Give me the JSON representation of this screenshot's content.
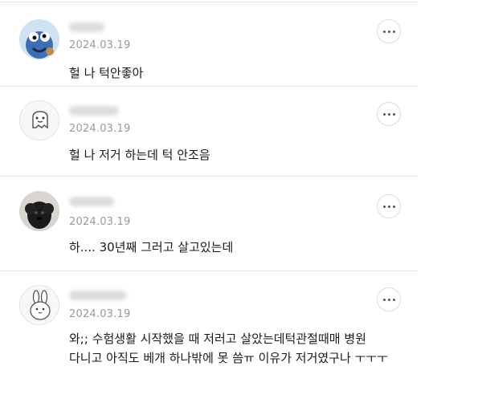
{
  "comments": [
    {
      "date": "2024.03.19",
      "text": "헐 나 턱안좋아",
      "avatar": "cookie-monster-avatar"
    },
    {
      "date": "2024.03.19",
      "text": "헐 나 저거 하는데 턱 안조음",
      "avatar": "ghost-character-avatar"
    },
    {
      "date": "2024.03.19",
      "text": "하.... 30년째 그러고 살고있는데",
      "avatar": "black-dog-avatar"
    },
    {
      "date": "2024.03.19",
      "text": "와;; 수험생활 시작했을 때 저러고 살았는데턱관절때매 병원 다니고 아직도 베개 하나밖에 못 씀ㅠ 이유가 저거였구나 ㅜㅜㅜ",
      "avatar": "rabbit-character-avatar"
    }
  ],
  "icons": {
    "more": "more-options-icon"
  }
}
